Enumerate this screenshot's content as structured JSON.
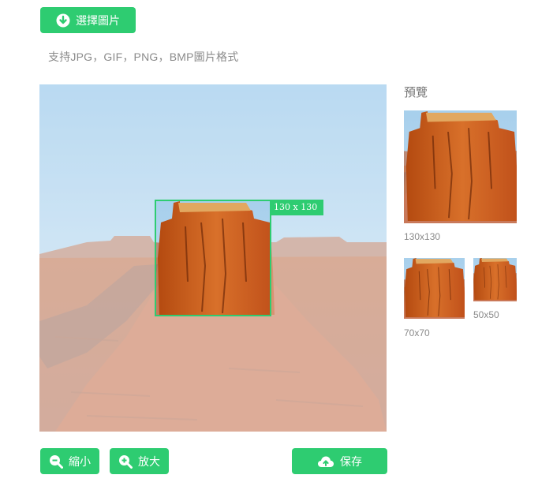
{
  "toolbar": {
    "choose_label": "選擇圖片",
    "hint": "支持JPG，GIF，PNG，BMP圖片格式"
  },
  "crop": {
    "size_label": "130 x 130"
  },
  "preview": {
    "title": "預覽",
    "sizes": [
      "130x130",
      "70x70",
      "50x50"
    ]
  },
  "actions": {
    "zoom_out_label": "縮小",
    "zoom_in_label": "放大",
    "save_label": "保存"
  },
  "icons": {
    "choose": "download-circle-icon",
    "zoom_out": "zoom-out-icon",
    "zoom_in": "zoom-in-icon",
    "save": "cloud-upload-icon"
  },
  "colors": {
    "accent": "#2ecc71"
  }
}
